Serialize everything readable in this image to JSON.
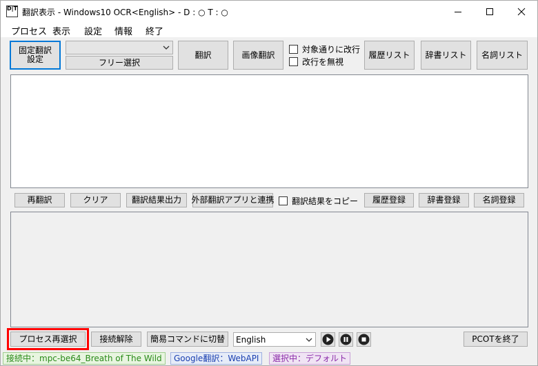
{
  "window": {
    "title": "翻訳表示 - Windows10 OCR<English> - D : ○ T : ○",
    "icon_text": "D|T",
    "controls": [
      "minimize-icon",
      "maximize-icon",
      "close-icon"
    ]
  },
  "menu": [
    "プロセス",
    "表示",
    "設定",
    "情報",
    "終了"
  ],
  "toolbar": {
    "fixed_translation": "固定翻訳\n設定",
    "combo_value": "",
    "free_select": "フリー選択",
    "translate": "翻訳",
    "image_translate": "画像翻訳",
    "chk_linebreak": "対象通りに改行",
    "chk_ignore_break": "改行を無視",
    "history_list": "履歴リスト",
    "dict_list": "辞書リスト",
    "noun_list": "名詞リスト"
  },
  "source_text": "",
  "actions": {
    "retranslate": "再翻訳",
    "clear": "クリア",
    "output_result": "翻訳結果出力",
    "external_app": "外部翻訳アプリと連携",
    "chk_copy": "翻訳結果をコピー",
    "history_register": "履歴登録",
    "dict_register": "辞書登録",
    "noun_register": "名詞登録"
  },
  "result_text": "",
  "bottom": {
    "reselect_process": "プロセス再選択",
    "disconnect": "接続解除",
    "simple_command": "簡易コマンドに切替",
    "language": "English",
    "media_icons": [
      "play-icon",
      "pause-icon",
      "stop-icon"
    ],
    "exit_pcot": "PCOTを終了"
  },
  "status": {
    "connecting": "接続中：mpc-be64_Breath of The Wild",
    "google": "Google翻訳：WebAPI",
    "selected": "選択中：デフォルト"
  },
  "colors": {
    "status_green_bg": "#e8f5e0",
    "status_green_text": "#2a8a1a",
    "status_blue_bg": "#e6ecf8",
    "status_blue_text": "#1a3fb0",
    "status_purple_bg": "#f0e4f4",
    "status_purple_text": "#8a2aa8",
    "highlight": "#ff0000",
    "focus": "#0078d7"
  }
}
